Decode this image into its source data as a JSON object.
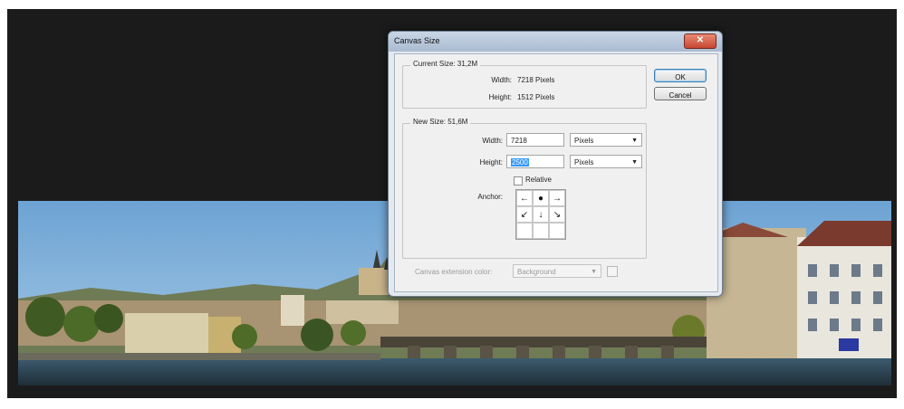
{
  "dialog": {
    "title": "Canvas Size",
    "close_icon": "close-icon",
    "current": {
      "legend": "Current Size: 31,2M",
      "width_label": "Width:",
      "width_value": "7218 Pixels",
      "height_label": "Height:",
      "height_value": "1512 Pixels"
    },
    "new": {
      "legend": "New Size: 51,6M",
      "width_label": "Width:",
      "width_value": "7218",
      "width_unit": "Pixels",
      "height_label": "Height:",
      "height_value": "2500",
      "height_unit": "Pixels",
      "relative_label": "Relative",
      "relative_checked": false,
      "anchor_label": "Anchor:",
      "anchor_cells": [
        "←",
        "●",
        "→",
        "↙",
        "↓",
        "↘",
        "",
        "",
        ""
      ]
    },
    "extension_color_label": "Canvas extension color:",
    "extension_color_value": "Background",
    "ok_label": "OK",
    "cancel_label": "Cancel"
  },
  "colors": {
    "workspace": "#1b1b1b",
    "sky": "#84b3dc",
    "selection": "#3399ff"
  }
}
